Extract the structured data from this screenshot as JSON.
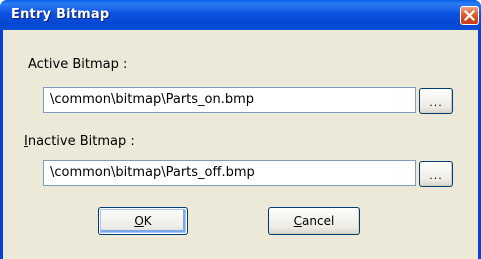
{
  "window": {
    "title": "Entry Bitmap",
    "close_icon": "close-icon"
  },
  "active": {
    "label": "Active Bitmap :",
    "value": "\\common\\bitmap\\Parts_on.bmp",
    "browse_label": "..."
  },
  "inactive": {
    "label_mnemonic": "I",
    "label_rest": "nactive Bitmap :",
    "value": "\\common\\bitmap\\Parts_off.bmp",
    "browse_label": "..."
  },
  "buttons": {
    "ok_mnemonic": "O",
    "ok_rest": "K",
    "cancel_mnemonic": "C",
    "cancel_rest": "ancel"
  },
  "colors": {
    "titlebar": "#0a52e0",
    "client_background": "#ece9d8",
    "close_button": "#d2461c",
    "textbox_border": "#7f9db9"
  }
}
